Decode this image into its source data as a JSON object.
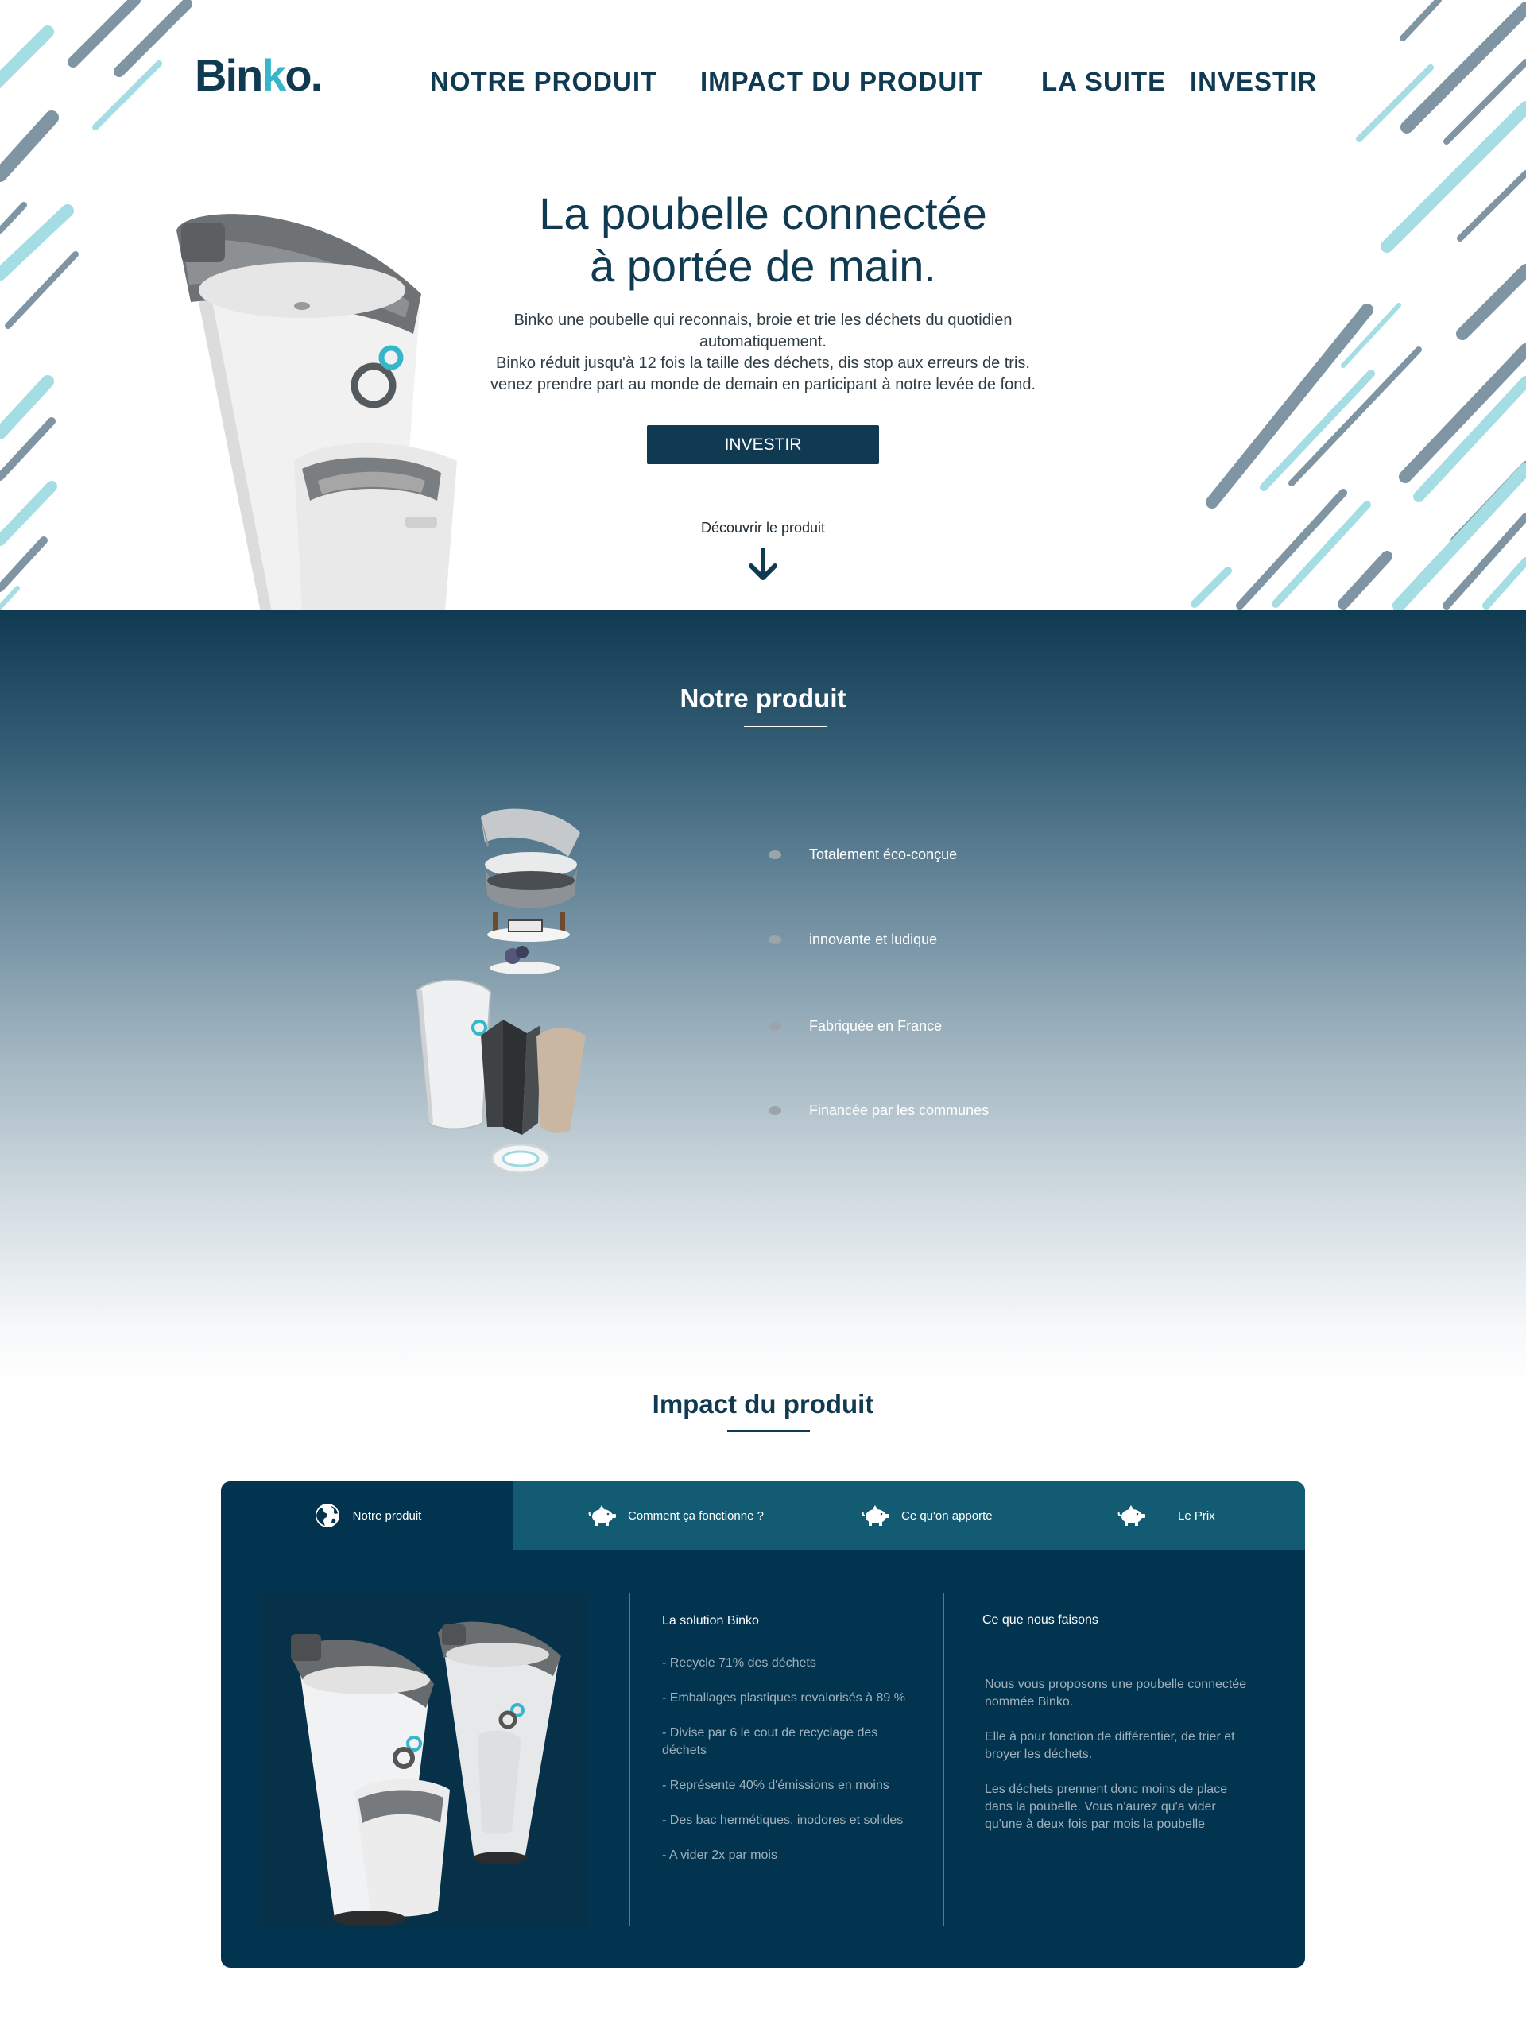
{
  "brand": {
    "logo_prefix": "Bin",
    "logo_k": "k",
    "logo_suffix": "o."
  },
  "nav": {
    "items": [
      {
        "label": "NOTRE PRODUIT"
      },
      {
        "label": "IMPACT DU PRODUIT"
      },
      {
        "label": "LA SUITE"
      },
      {
        "label": "INVESTIR"
      }
    ]
  },
  "hero": {
    "title_line1": "La poubelle connectée",
    "title_line2": "à portée de main.",
    "desc": [
      "Binko une poubelle qui reconnais, broie et trie les déchets du quotidien",
      "automatiquement.",
      "Binko réduit jusqu'à 12 fois la taille des déchets, dis stop aux erreurs de tris.",
      "venez prendre part au monde de demain en participant à notre levée de fond."
    ],
    "cta_label": "INVESTIR",
    "discover_label": "Découvrir le produit"
  },
  "product": {
    "title": "Notre produit",
    "features": [
      {
        "label": "Totalement éco-conçue"
      },
      {
        "label": "innovante et ludique"
      },
      {
        "label": "Fabriquée en France"
      },
      {
        "label": "Financée par les communes"
      }
    ]
  },
  "impact": {
    "title": "Impact du produit",
    "tabs": [
      {
        "label": "Notre produit",
        "icon": "globe-icon"
      },
      {
        "label": "Comment ça fonctionne ?",
        "icon": "piggy-bank-icon"
      },
      {
        "label": "Ce qu'on apporte",
        "icon": "piggy-bank-icon"
      },
      {
        "label": "Le Prix",
        "icon": "piggy-bank-icon"
      }
    ],
    "solution": {
      "title": "La solution Binko",
      "items": [
        "- Recycle 71% des déchets",
        "- Emballages plastiques revalorisés à 89 %",
        "- Divise par 6 le cout de recyclage des déchets",
        "- Représente 40% d'émissions en moins",
        "- Des bac hermétiques, inodores et solides",
        "- A vider 2x par mois"
      ]
    },
    "what_we_do": {
      "title": "Ce que nous faisons",
      "paragraphs": [
        "Nous vous proposons une poubelle connectée nommée Binko.",
        "Elle à pour fonction de différentier, de trier et broyer les déchets.",
        "Les déchets prennent donc moins de place dans la poubelle. Vous n'aurez qu'a vider qu'une à deux fois par mois la poubelle"
      ]
    }
  },
  "colors": {
    "primary": "#0f3a52",
    "accent": "#35b7c9",
    "panel": "#02344f",
    "tabbar": "#135b73",
    "stripe_grey": "#7f95a3",
    "stripe_cyan": "#a4dde3"
  }
}
